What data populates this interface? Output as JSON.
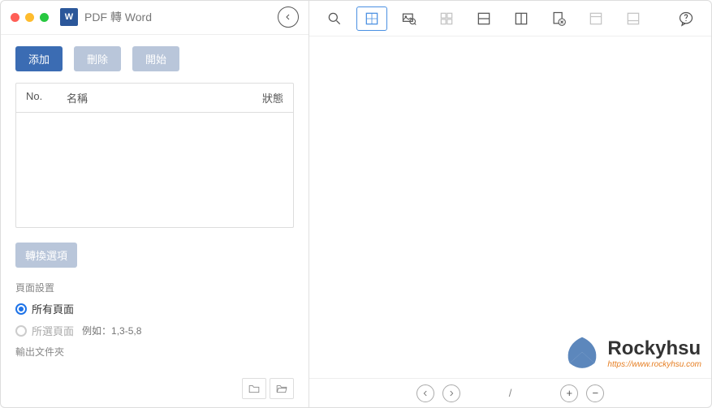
{
  "window": {
    "title": "PDF 轉 Word"
  },
  "buttons": {
    "add": "添加",
    "delete": "刪除",
    "start": "開始",
    "convert_options": "轉換選項"
  },
  "table": {
    "no": "No.",
    "name": "名稱",
    "status": "狀態"
  },
  "page_settings": {
    "heading": "頁面設置",
    "all_pages": "所有頁面",
    "selected_pages": "所選頁面",
    "placeholder": "例如：1,3-5,8"
  },
  "output": {
    "label": "輸出文件夾"
  },
  "pager": {
    "sep": "/"
  },
  "watermark": {
    "name": "Rockyhsu",
    "url": "https://www.rockyhsu.com"
  }
}
